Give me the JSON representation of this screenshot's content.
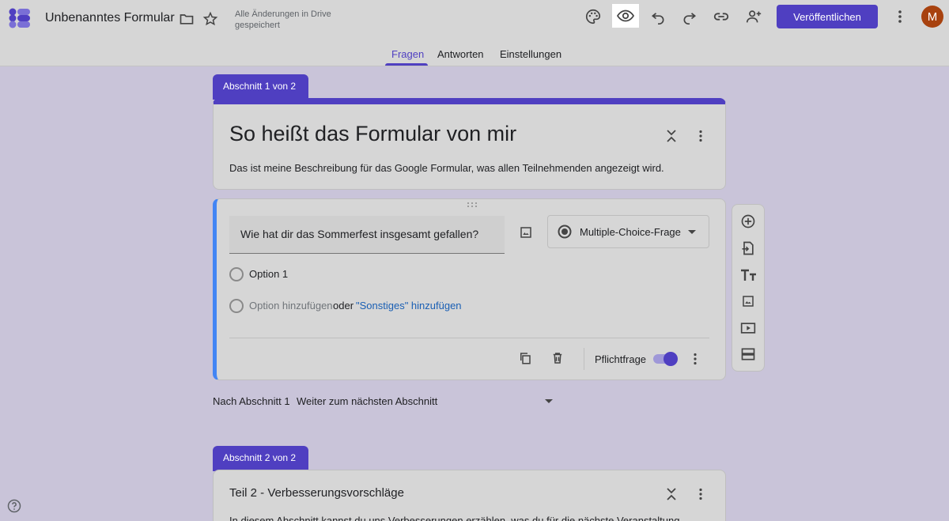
{
  "header": {
    "title": "Unbenanntes Formular",
    "save_status": "Alle Änderungen in Drive gespeichert",
    "publish_label": "Veröffentlichen",
    "avatar_initial": "M"
  },
  "tabs": [
    {
      "label": "Fragen",
      "active": true
    },
    {
      "label": "Antworten",
      "active": false
    },
    {
      "label": "Einstellungen",
      "active": false
    }
  ],
  "section1": {
    "tab_label": "Abschnitt 1 von 2",
    "form_title": "So heißt das Formular von mir",
    "form_description": "Das ist meine Beschreibung für das Google Formular, was allen Teilnehmenden angezeigt wird."
  },
  "question": {
    "text": "Wie hat dir das Sommerfest insgesamt gefallen?",
    "type": "Multiple-Choice-Frage",
    "options": [
      "Option 1"
    ],
    "add_option": "Option hinzufügen",
    "or": "oder",
    "add_other": "\"Sonstiges\" hinzufügen",
    "required_label": "Pflichtfrage",
    "required": true
  },
  "after_section": {
    "label": "Nach Abschnitt 1",
    "value": "Weiter zum nächsten Abschnitt"
  },
  "section2": {
    "tab_label": "Abschnitt 2 von 2",
    "title": "Teil 2 - Verbesserungsvorschläge",
    "description": "In diesem Abschnitt kannst du uns Verbesserungen erzählen, was du für die nächste Veranstaltung..."
  },
  "colors": {
    "accent": "#4f3fc1",
    "question_border": "#4285f4",
    "avatar": "#a8420f"
  }
}
